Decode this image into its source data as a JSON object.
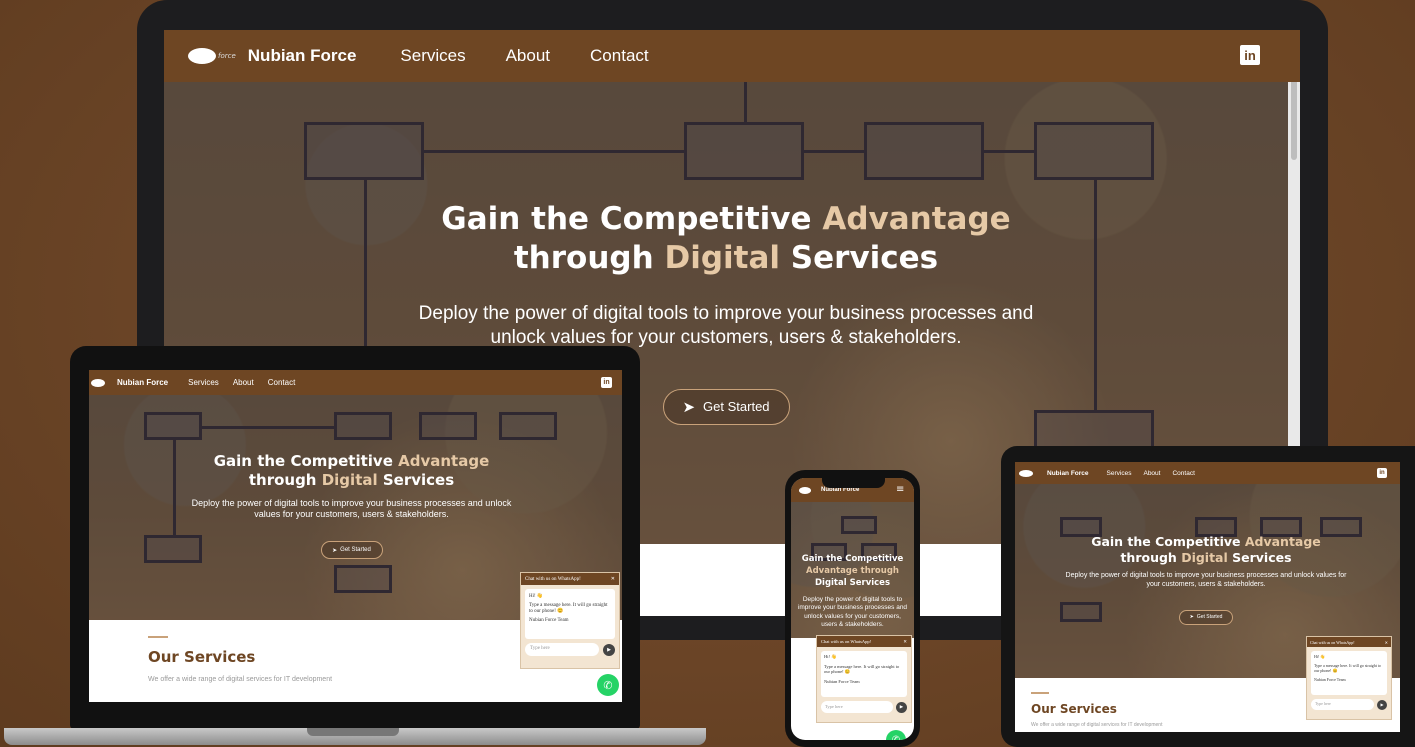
{
  "brand": {
    "name": "Nubian Force",
    "logo_text": "Nubian Force"
  },
  "nav": {
    "services": "Services",
    "about": "About",
    "contact": "Contact",
    "linkedin": "in",
    "menu_icon": "hamburger-icon"
  },
  "hero": {
    "title_part1": "Gain the Competitive ",
    "title_highlight1": "Advantage",
    "title_part2": "through ",
    "title_highlight2": "Digital",
    "title_part3": " Services",
    "subtitle": "Deploy the power of digital tools to improve your business processes and unlock values for your customers, users & stakeholders.",
    "cta": "Get Started"
  },
  "services_section": {
    "heading": "Our Services",
    "description": "We offer a wide range of digital services for IT development"
  },
  "chat": {
    "header": "Chat with us on WhatsApp!",
    "greeting": "Hi! 👋",
    "message": "Type a message here. It will go straight to our phone! 😊",
    "signature": "Nubian Force Team",
    "placeholder": "Type here"
  },
  "colors": {
    "brand_brown": "#6e4623",
    "accent_tan": "#e6c9a6",
    "whatsapp_green": "#25d366"
  }
}
